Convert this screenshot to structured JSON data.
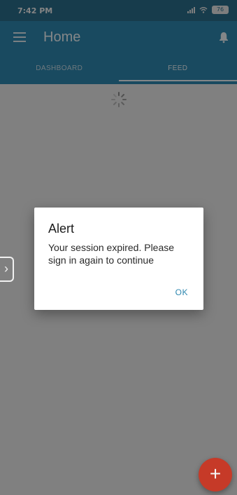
{
  "status_bar": {
    "time": "7:42 PM",
    "battery": "76",
    "signal_icon": "signal-icon",
    "wifi_icon": "wifi-icon",
    "battery_icon": "battery-icon"
  },
  "app_bar": {
    "menu_icon": "menu-icon",
    "title": "Home",
    "bell_icon": "bell-icon"
  },
  "tabs": [
    {
      "label": "DASHBOARD",
      "active": false
    },
    {
      "label": "FEED",
      "active": true
    }
  ],
  "content": {
    "spinner_icon": "spinner-icon",
    "side_handle_icon": "chevron-right-icon"
  },
  "dialog": {
    "title": "Alert",
    "message": "Your session expired. Please sign in again to continue",
    "ok_label": "OK"
  },
  "fab": {
    "label": "+",
    "icon": "plus-icon"
  },
  "colors": {
    "status_bar": "#2b6e8b",
    "app_bar": "#2f88b0",
    "fab": "#c63a28",
    "dialog_button": "#2f88b0"
  }
}
